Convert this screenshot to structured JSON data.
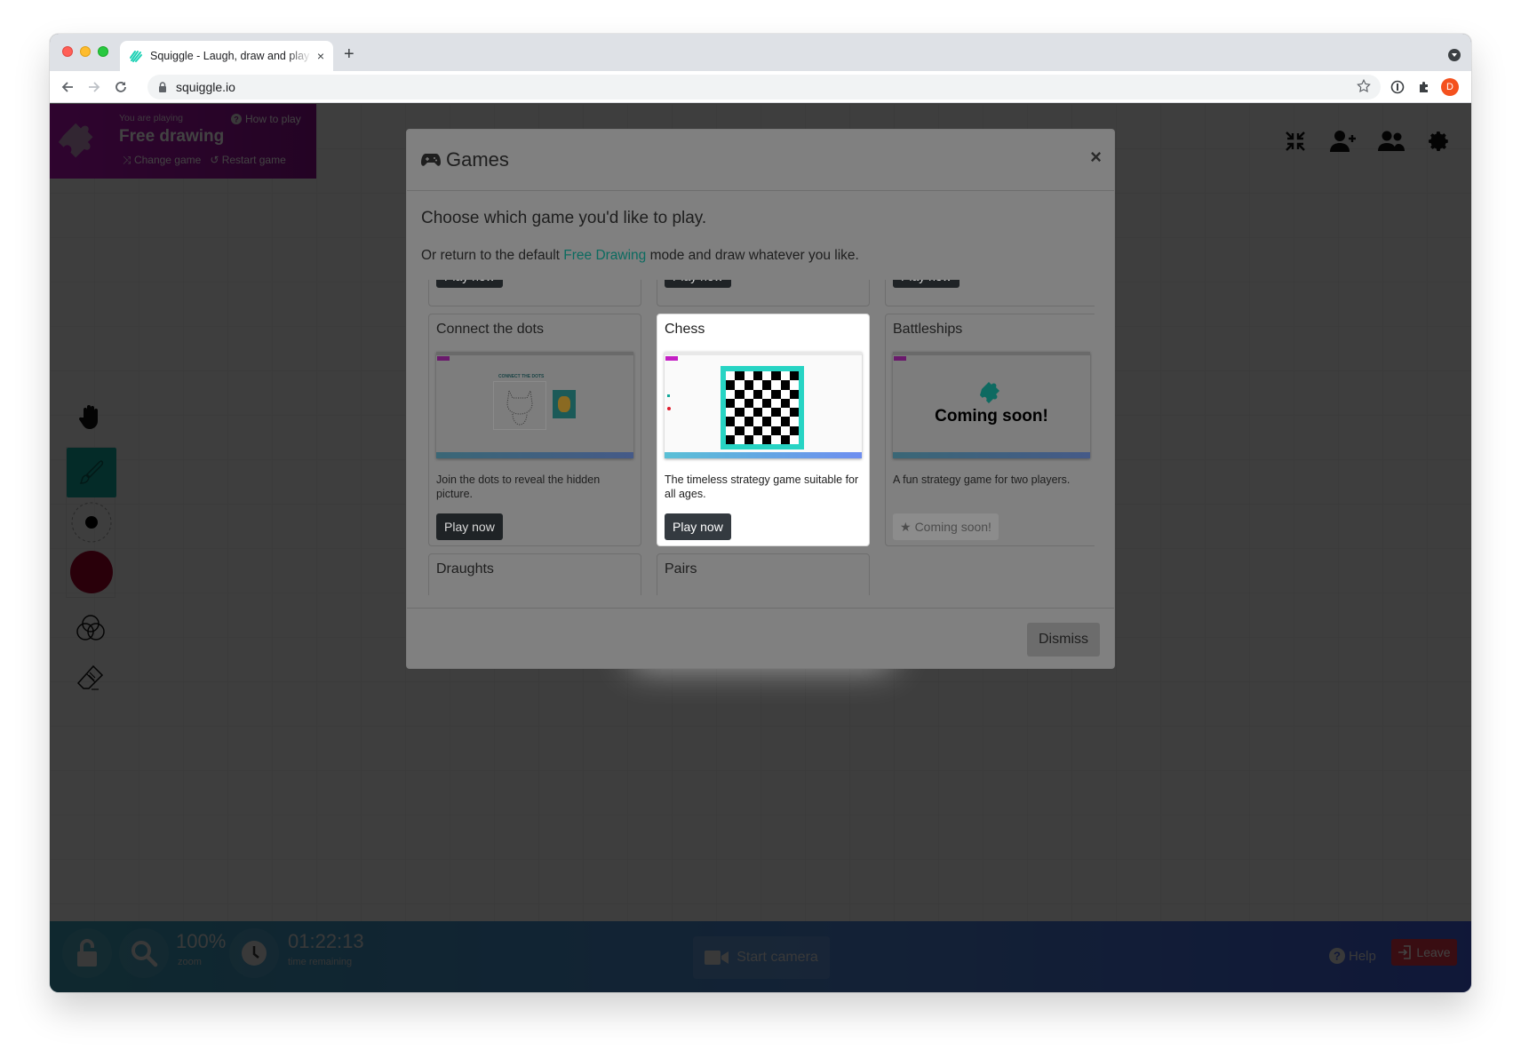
{
  "browser": {
    "tab_title": "Squiggle - Laugh, draw and play together",
    "tab_close": "×",
    "new_tab": "+",
    "url": "squiggle.io",
    "profile_initial": "D",
    "brand_color": "#1fd1b5"
  },
  "game_panel": {
    "prefix": "You are playing",
    "game_name": "Free drawing",
    "how_to_play": "How to play",
    "change_game": "Change game",
    "restart_game": "Restart game"
  },
  "top_icons": [
    "compress-icon",
    "add-user-icon",
    "users-icon",
    "settings-icon"
  ],
  "tools": [
    {
      "name": "hand-icon"
    },
    {
      "name": "brush-icon",
      "active": true
    },
    {
      "name": "brush-size-icon"
    },
    {
      "name": "color-swatch",
      "color": "#a0002a"
    },
    {
      "name": "color-mix-icon"
    },
    {
      "name": "eraser-icon"
    }
  ],
  "bottom_bar": {
    "zoom_value": "100%",
    "zoom_label": "zoom",
    "time_value": "01:22:13",
    "time_label": "time remaining",
    "camera_label": "Start camera",
    "help_label": "Help",
    "leave_label": "Leave"
  },
  "modal": {
    "title": "Games",
    "close": "×",
    "lead": "Choose which game you'd like to play.",
    "sub_before": "Or return to the default ",
    "sub_link": "Free Drawing",
    "sub_after": " mode and draw whatever you like.",
    "top_row_buttons": [
      "Play now",
      "Play now",
      "Play now"
    ],
    "cards": [
      {
        "title": "Connect the dots",
        "description": "Join the dots to reveal the hidden picture.",
        "button": "Play now",
        "thumb_text": "CONNECT THE DOTS"
      },
      {
        "title": "Chess",
        "description": "The timeless strategy game suitable for all ages.",
        "button": "Play now"
      },
      {
        "title": "Battleships",
        "description": "A fun strategy game for two players.",
        "button": "Coming soon!",
        "thumb_text": "Coming soon!",
        "coming_soon": true
      }
    ],
    "bottom_row": [
      {
        "title": "Draughts"
      },
      {
        "title": "Pairs"
      }
    ],
    "dismiss": "Dismiss",
    "link_color": "#11a89a"
  }
}
